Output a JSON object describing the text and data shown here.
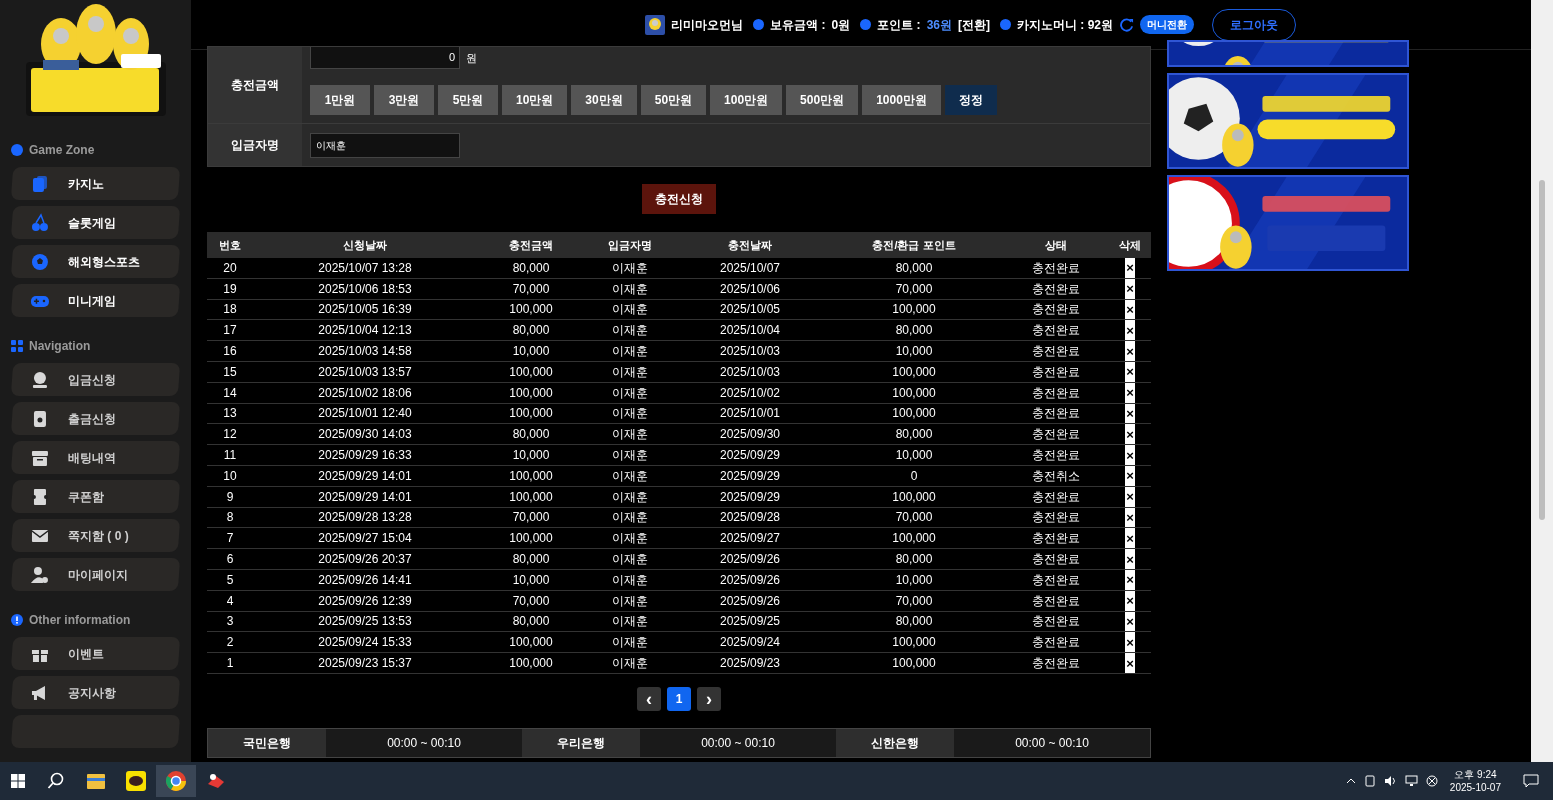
{
  "sidebar": {
    "sections": [
      {
        "title": "Game Zone",
        "kind": "coin",
        "items": [
          {
            "label": "카지노",
            "highlight": true
          },
          {
            "label": "슬롯게임",
            "highlight": true
          },
          {
            "label": "해외형스포츠",
            "highlight": true
          },
          {
            "label": "미니게임",
            "highlight": true
          }
        ]
      },
      {
        "title": "Navigation",
        "kind": "grid",
        "items": [
          {
            "label": "입금신청",
            "highlight": false
          },
          {
            "label": "출금신청",
            "highlight": false
          },
          {
            "label": "배팅내역",
            "highlight": false
          },
          {
            "label": "쿠폰함",
            "highlight": false
          },
          {
            "label": "쪽지함 ( 0 )",
            "highlight": false
          },
          {
            "label": "마이페이지",
            "highlight": false
          }
        ]
      },
      {
        "title": "Other information",
        "kind": "info",
        "items": [
          {
            "label": "이벤트",
            "highlight": false
          },
          {
            "label": "공지사항",
            "highlight": false
          }
        ]
      }
    ]
  },
  "topbar": {
    "user": "리미마오먼님",
    "balance_label": "보유금액 :",
    "balance": "0원",
    "point_label": "포인트 :",
    "point": "36원",
    "convert": "[전환]",
    "casino_label": "카지노머니 : 92원",
    "money_convert": "머니전환",
    "logout": "로그아웃"
  },
  "form": {
    "amount_label": "충전금액",
    "amount_value": "0",
    "amount_unit": "원",
    "presets": [
      "1만원",
      "3만원",
      "5만원",
      "10만원",
      "30만원",
      "50만원",
      "100만원",
      "500만원",
      "1000만원"
    ],
    "reset": "정정",
    "name_label": "입금자명",
    "name_value": "이재훈",
    "submit": "충전신청"
  },
  "table": {
    "columns": [
      "번호",
      "신청날짜",
      "충전금액",
      "입금자명",
      "충전날짜",
      "충전/환급 포인트",
      "상태",
      "삭제"
    ],
    "rows": [
      [
        "20",
        "2025/10/07 13:28",
        "80,000",
        "이재훈",
        "2025/10/07",
        "80,000",
        "충전완료"
      ],
      [
        "19",
        "2025/10/06 18:53",
        "70,000",
        "이재훈",
        "2025/10/06",
        "70,000",
        "충전완료"
      ],
      [
        "18",
        "2025/10/05 16:39",
        "100,000",
        "이재훈",
        "2025/10/05",
        "100,000",
        "충전완료"
      ],
      [
        "17",
        "2025/10/04 12:13",
        "80,000",
        "이재훈",
        "2025/10/04",
        "80,000",
        "충전완료"
      ],
      [
        "16",
        "2025/10/03 14:58",
        "10,000",
        "이재훈",
        "2025/10/03",
        "10,000",
        "충전완료"
      ],
      [
        "15",
        "2025/10/03 13:57",
        "100,000",
        "이재훈",
        "2025/10/03",
        "100,000",
        "충전완료"
      ],
      [
        "14",
        "2025/10/02 18:06",
        "100,000",
        "이재훈",
        "2025/10/02",
        "100,000",
        "충전완료"
      ],
      [
        "13",
        "2025/10/01 12:40",
        "100,000",
        "이재훈",
        "2025/10/01",
        "100,000",
        "충전완료"
      ],
      [
        "12",
        "2025/09/30 14:03",
        "80,000",
        "이재훈",
        "2025/09/30",
        "80,000",
        "충전완료"
      ],
      [
        "11",
        "2025/09/29 16:33",
        "10,000",
        "이재훈",
        "2025/09/29",
        "10,000",
        "충전완료"
      ],
      [
        "10",
        "2025/09/29 14:01",
        "100,000",
        "이재훈",
        "2025/09/29",
        "0",
        "충전취소"
      ],
      [
        "9",
        "2025/09/29 14:01",
        "100,000",
        "이재훈",
        "2025/09/29",
        "100,000",
        "충전완료"
      ],
      [
        "8",
        "2025/09/28 13:28",
        "70,000",
        "이재훈",
        "2025/09/28",
        "70,000",
        "충전완료"
      ],
      [
        "7",
        "2025/09/27 15:04",
        "100,000",
        "이재훈",
        "2025/09/27",
        "100,000",
        "충전완료"
      ],
      [
        "6",
        "2025/09/26 20:37",
        "80,000",
        "이재훈",
        "2025/09/26",
        "80,000",
        "충전완료"
      ],
      [
        "5",
        "2025/09/26 14:41",
        "10,000",
        "이재훈",
        "2025/09/26",
        "10,000",
        "충전완료"
      ],
      [
        "4",
        "2025/09/26 12:39",
        "70,000",
        "이재훈",
        "2025/09/26",
        "70,000",
        "충전완료"
      ],
      [
        "3",
        "2025/09/25 13:53",
        "80,000",
        "이재훈",
        "2025/09/25",
        "80,000",
        "충전완료"
      ],
      [
        "2",
        "2025/09/24 15:33",
        "100,000",
        "이재훈",
        "2025/09/24",
        "100,000",
        "충전완료"
      ],
      [
        "1",
        "2025/09/23 15:37",
        "100,000",
        "이재훈",
        "2025/09/23",
        "100,000",
        "충전완료"
      ]
    ],
    "delete_mark": "×"
  },
  "pagination": {
    "prev": "‹",
    "pages": [
      {
        "label": "1",
        "selected": true
      }
    ],
    "next": "›"
  },
  "banks": [
    {
      "name": "국민은행",
      "hours": "00:00 ~ 00:10"
    },
    {
      "name": "우리은행",
      "hours": "00:00 ~ 00:10"
    },
    {
      "name": "신한은행",
      "hours": "00:00 ~ 00:10"
    }
  ],
  "taskbar": {
    "time": "오후 9:24",
    "date": "2025-10-07"
  }
}
